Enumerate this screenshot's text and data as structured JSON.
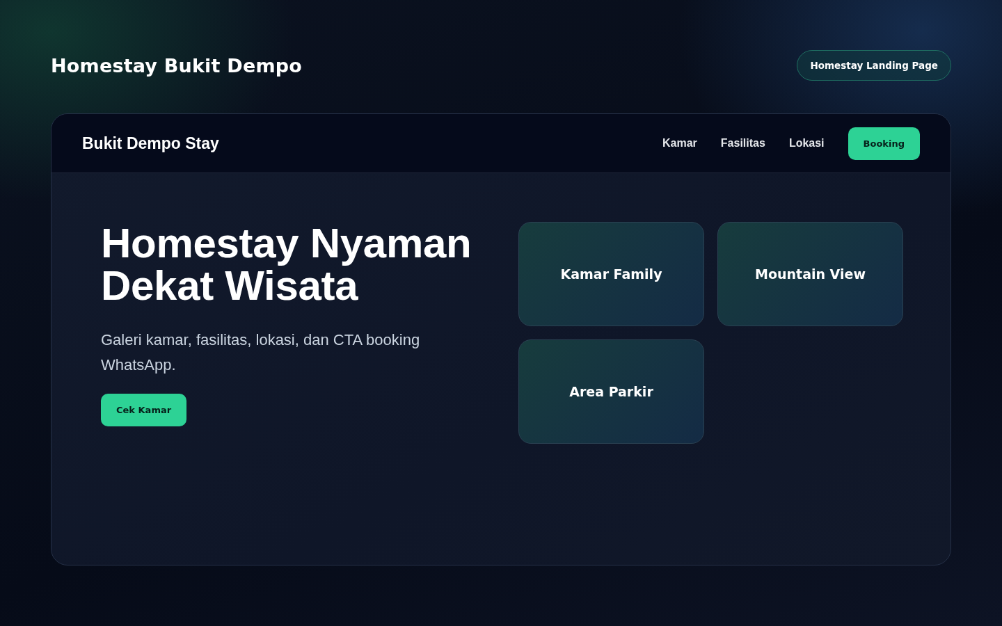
{
  "page_title": "Homestay Bukit Dempo",
  "badge": "Homestay Landing Page",
  "navbar": {
    "brand": "Bukit Dempo Stay",
    "links": [
      {
        "label": "Kamar"
      },
      {
        "label": "Fasilitas"
      },
      {
        "label": "Lokasi"
      }
    ],
    "cta": "Booking"
  },
  "hero": {
    "heading_lines": [
      "Homestay Nyaman",
      "Dekat Wisata"
    ],
    "description": "Galeri kamar, fasilitas, lokasi, dan CTA booking WhatsApp.",
    "button": "Cek Kamar"
  },
  "gallery": [
    {
      "label": "Kamar Family"
    },
    {
      "label": "Mountain View"
    },
    {
      "label": "Area Parkir"
    }
  ]
}
